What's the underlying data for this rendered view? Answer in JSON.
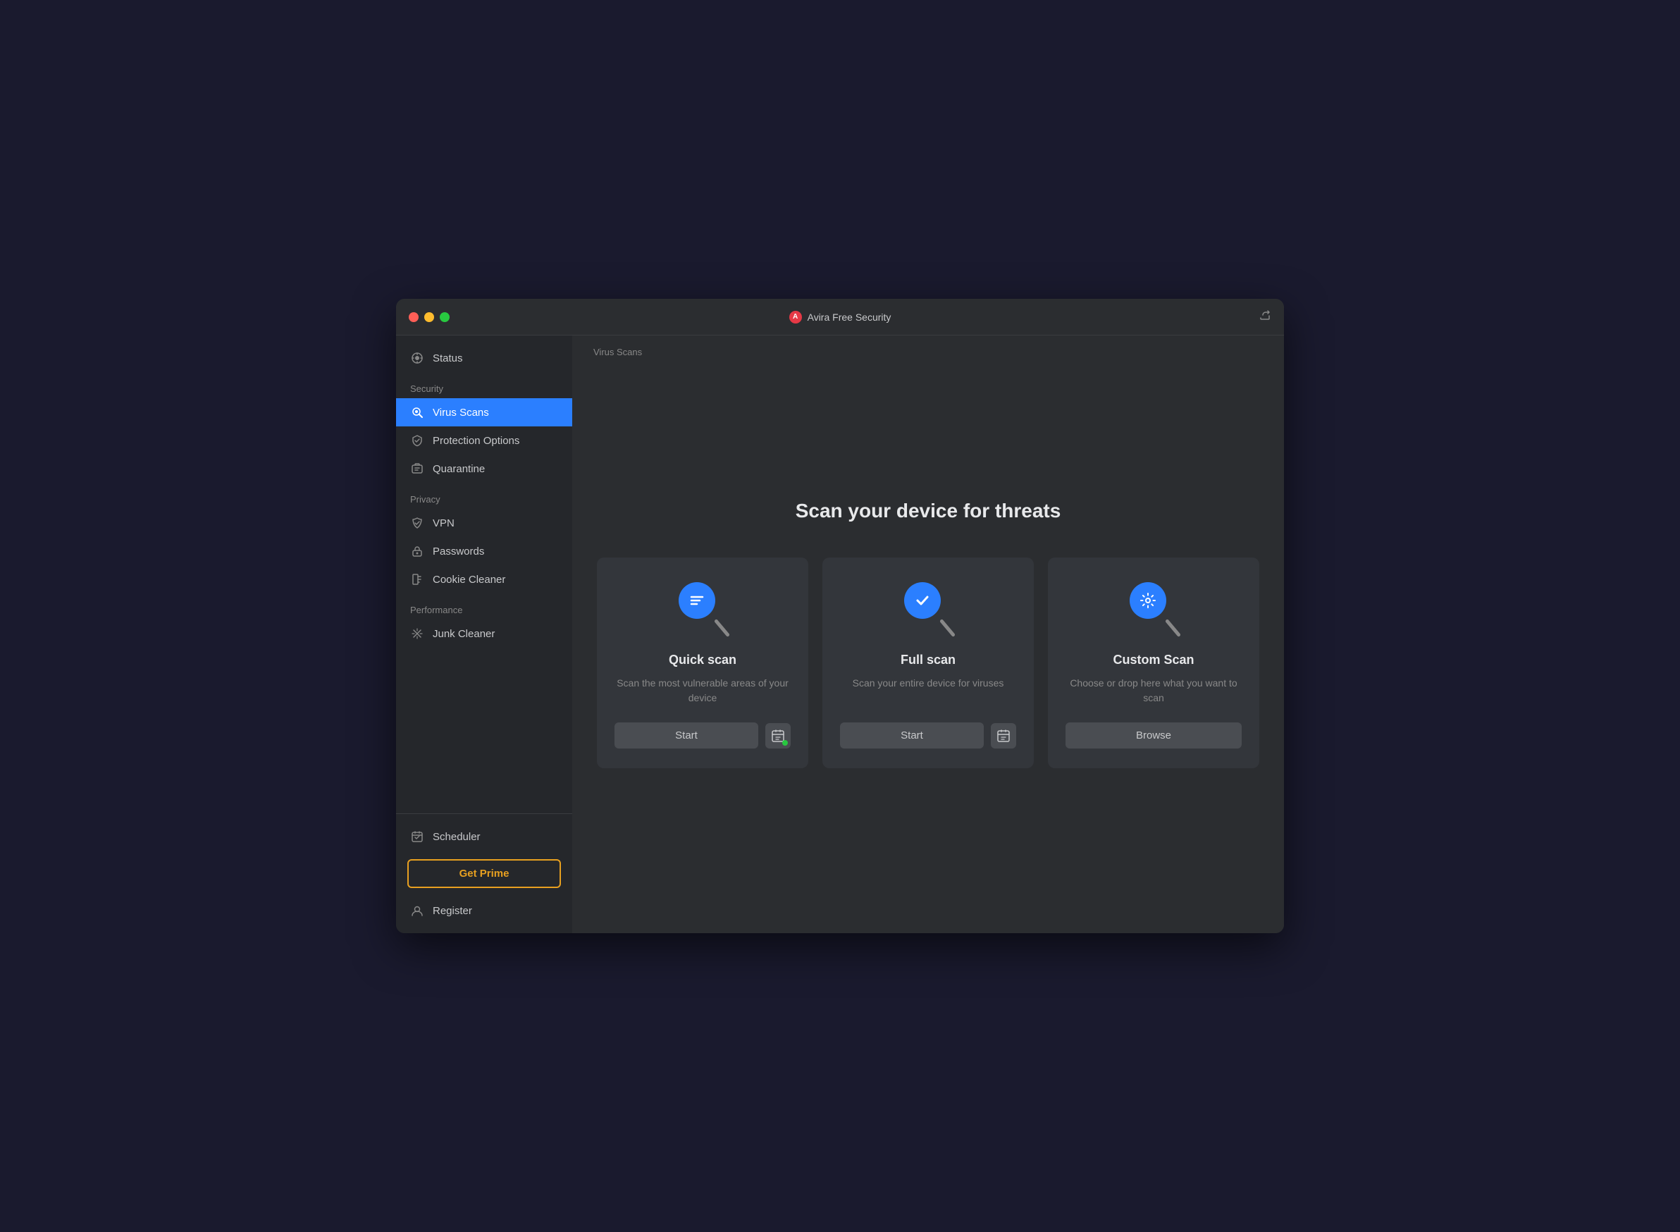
{
  "window": {
    "title": "Avira Free Security"
  },
  "titlebar": {
    "title": "Avira Free Security",
    "icon": "A"
  },
  "sidebar": {
    "status_label": "Status",
    "sections": [
      {
        "label": "Security",
        "items": [
          {
            "id": "virus-scans",
            "label": "Virus Scans",
            "active": true
          },
          {
            "id": "protection-options",
            "label": "Protection Options",
            "active": false
          },
          {
            "id": "quarantine",
            "label": "Quarantine",
            "active": false
          }
        ]
      },
      {
        "label": "Privacy",
        "items": [
          {
            "id": "vpn",
            "label": "VPN",
            "active": false
          },
          {
            "id": "passwords",
            "label": "Passwords",
            "active": false
          },
          {
            "id": "cookie-cleaner",
            "label": "Cookie Cleaner",
            "active": false
          }
        ]
      },
      {
        "label": "Performance",
        "items": [
          {
            "id": "junk-cleaner",
            "label": "Junk Cleaner",
            "active": false
          }
        ]
      }
    ],
    "scheduler_label": "Scheduler",
    "get_prime_label": "Get Prime",
    "register_label": "Register"
  },
  "content": {
    "breadcrumb": "Virus Scans",
    "page_title": "Scan your device for threats",
    "cards": [
      {
        "id": "quick-scan",
        "title": "Quick scan",
        "description": "Scan the most vulnerable areas of your device",
        "icon_type": "list",
        "has_schedule": true,
        "schedule_active": true,
        "button_label": "Start"
      },
      {
        "id": "full-scan",
        "title": "Full scan",
        "description": "Scan your entire device for viruses",
        "icon_type": "check",
        "has_schedule": true,
        "schedule_active": false,
        "button_label": "Start"
      },
      {
        "id": "custom-scan",
        "title": "Custom Scan",
        "description": "Choose or drop here what you want to scan",
        "icon_type": "gear",
        "has_schedule": false,
        "button_label": "Browse"
      }
    ]
  }
}
